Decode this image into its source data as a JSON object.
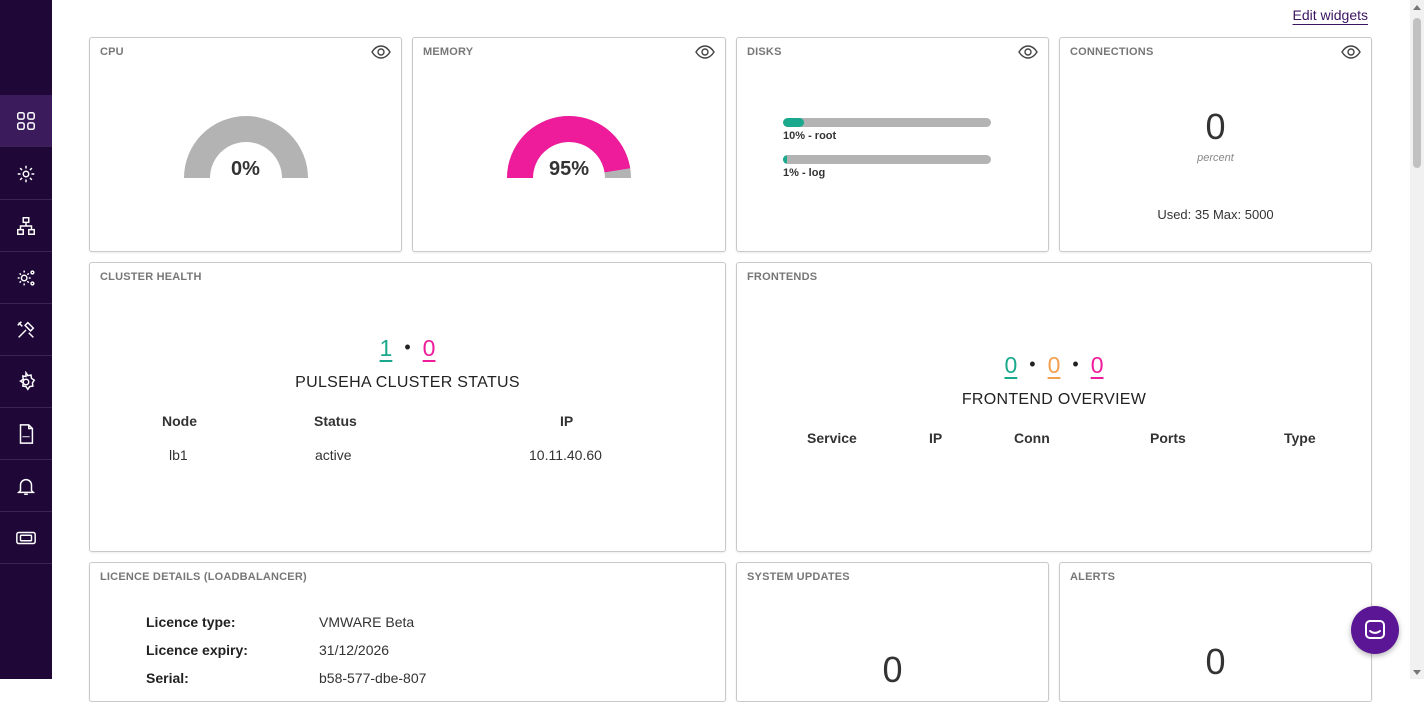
{
  "header": {
    "edit_widgets": "Edit widgets"
  },
  "sidebar": {
    "items": [
      {
        "icon": "dashboard-icon",
        "active": true
      },
      {
        "icon": "cluster-settings-icon"
      },
      {
        "icon": "network-icon"
      },
      {
        "icon": "services-icon"
      },
      {
        "icon": "tools-icon"
      },
      {
        "icon": "settings-icon"
      },
      {
        "icon": "log-icon"
      },
      {
        "icon": "bell-icon"
      },
      {
        "icon": "ticket-icon"
      }
    ]
  },
  "cpu": {
    "title": "CPU",
    "value_label": "0%",
    "value": 0
  },
  "memory": {
    "title": "MEMORY",
    "value_label": "95%",
    "value": 95
  },
  "disks": {
    "title": "DISKS",
    "items": [
      {
        "label": "10% - root",
        "percent": 10
      },
      {
        "label": "1% - log",
        "percent": 1
      }
    ]
  },
  "connections": {
    "title": "CONNECTIONS",
    "value": "0",
    "unit": "percent",
    "usage": "Used: 35 Max: 5000"
  },
  "cluster": {
    "title": "CLUSTER HEALTH",
    "count_ok": "1",
    "count_bad": "0",
    "status_title": "PULSEHA CLUSTER STATUS",
    "columns": [
      "Node",
      "Status",
      "IP"
    ],
    "rows": [
      [
        "lb1",
        "active",
        "10.11.40.60"
      ]
    ]
  },
  "frontends": {
    "title": "FRONTENDS",
    "count_ok": "0",
    "count_warn": "0",
    "count_bad": "0",
    "overview_title": "FRONTEND OVERVIEW",
    "columns": [
      "Service",
      "IP",
      "Conn",
      "Ports",
      "Type"
    ]
  },
  "licence": {
    "title": "LICENCE DETAILS (LOADBALANCER)",
    "rows": [
      {
        "key": "Licence type:",
        "value": "VMWARE Beta"
      },
      {
        "key": "Licence expiry:",
        "value": "31/12/2026"
      },
      {
        "key": "Serial:",
        "value": "b58-577-dbe-807"
      }
    ]
  },
  "updates": {
    "title": "SYSTEM UPDATES",
    "value": "0"
  },
  "alerts": {
    "title": "ALERTS",
    "value": "0"
  },
  "colors": {
    "accent": "#3d1460",
    "green": "#1aa98c",
    "pink": "#ee1b9b",
    "orange": "#f2a04f",
    "gauge_bg": "#b3b3b3"
  }
}
